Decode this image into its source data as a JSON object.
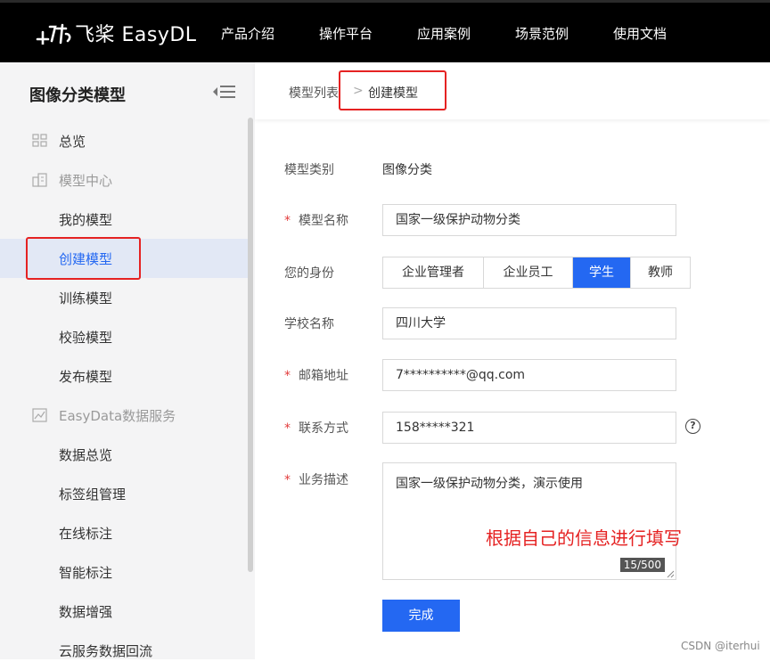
{
  "header": {
    "logo_text": "飞桨 EasyDL",
    "nav": [
      "产品介绍",
      "操作平台",
      "应用案例",
      "场景范例",
      "使用文档"
    ]
  },
  "sidebar": {
    "title": "图像分类模型",
    "items": [
      {
        "label": "总览",
        "kind": "top",
        "icon": "grid-icon"
      },
      {
        "label": "模型中心",
        "kind": "group",
        "icon": "building-icon"
      },
      {
        "label": "我的模型",
        "kind": "sub"
      },
      {
        "label": "创建模型",
        "kind": "sub",
        "active": true
      },
      {
        "label": "训练模型",
        "kind": "sub"
      },
      {
        "label": "校验模型",
        "kind": "sub"
      },
      {
        "label": "发布模型",
        "kind": "sub"
      },
      {
        "label": "EasyData数据服务",
        "kind": "group",
        "icon": "chart-icon"
      },
      {
        "label": "数据总览",
        "kind": "sub"
      },
      {
        "label": "标签组管理",
        "kind": "sub"
      },
      {
        "label": "在线标注",
        "kind": "sub"
      },
      {
        "label": "智能标注",
        "kind": "sub"
      },
      {
        "label": "数据增强",
        "kind": "sub"
      },
      {
        "label": "云服务数据回流",
        "kind": "sub"
      }
    ]
  },
  "breadcrumb": {
    "parent": "模型列表",
    "separator": ">",
    "current": "创建模型"
  },
  "form": {
    "model_type_label": "模型类别",
    "model_type_value": "图像分类",
    "required_mark": "*",
    "model_name_label": "模型名称",
    "model_name_value": "国家一级保护动物分类",
    "identity_label": "您的身份",
    "identity_options": [
      "企业管理者",
      "企业员工",
      "学生",
      "教师"
    ],
    "identity_selected": "学生",
    "school_label": "学校名称",
    "school_value": "四川大学",
    "email_label": "邮箱地址",
    "email_value": "7**********@qq.com",
    "phone_label": "联系方式",
    "phone_value": "158*****321",
    "help_icon": "?",
    "desc_label": "业务描述",
    "desc_value": "国家一级保护动物分类，演示使用",
    "desc_counter": "15/500",
    "submit_label": "完成"
  },
  "annotation": "根据自己的信息进行填写",
  "watermark": "CSDN @iterhui",
  "colors": {
    "accent": "#2468f2",
    "highlight_box": "#e52222",
    "topbar": "#000000",
    "sidebar_bg": "#f4f4f5",
    "active_row": "#e2e8f5"
  }
}
